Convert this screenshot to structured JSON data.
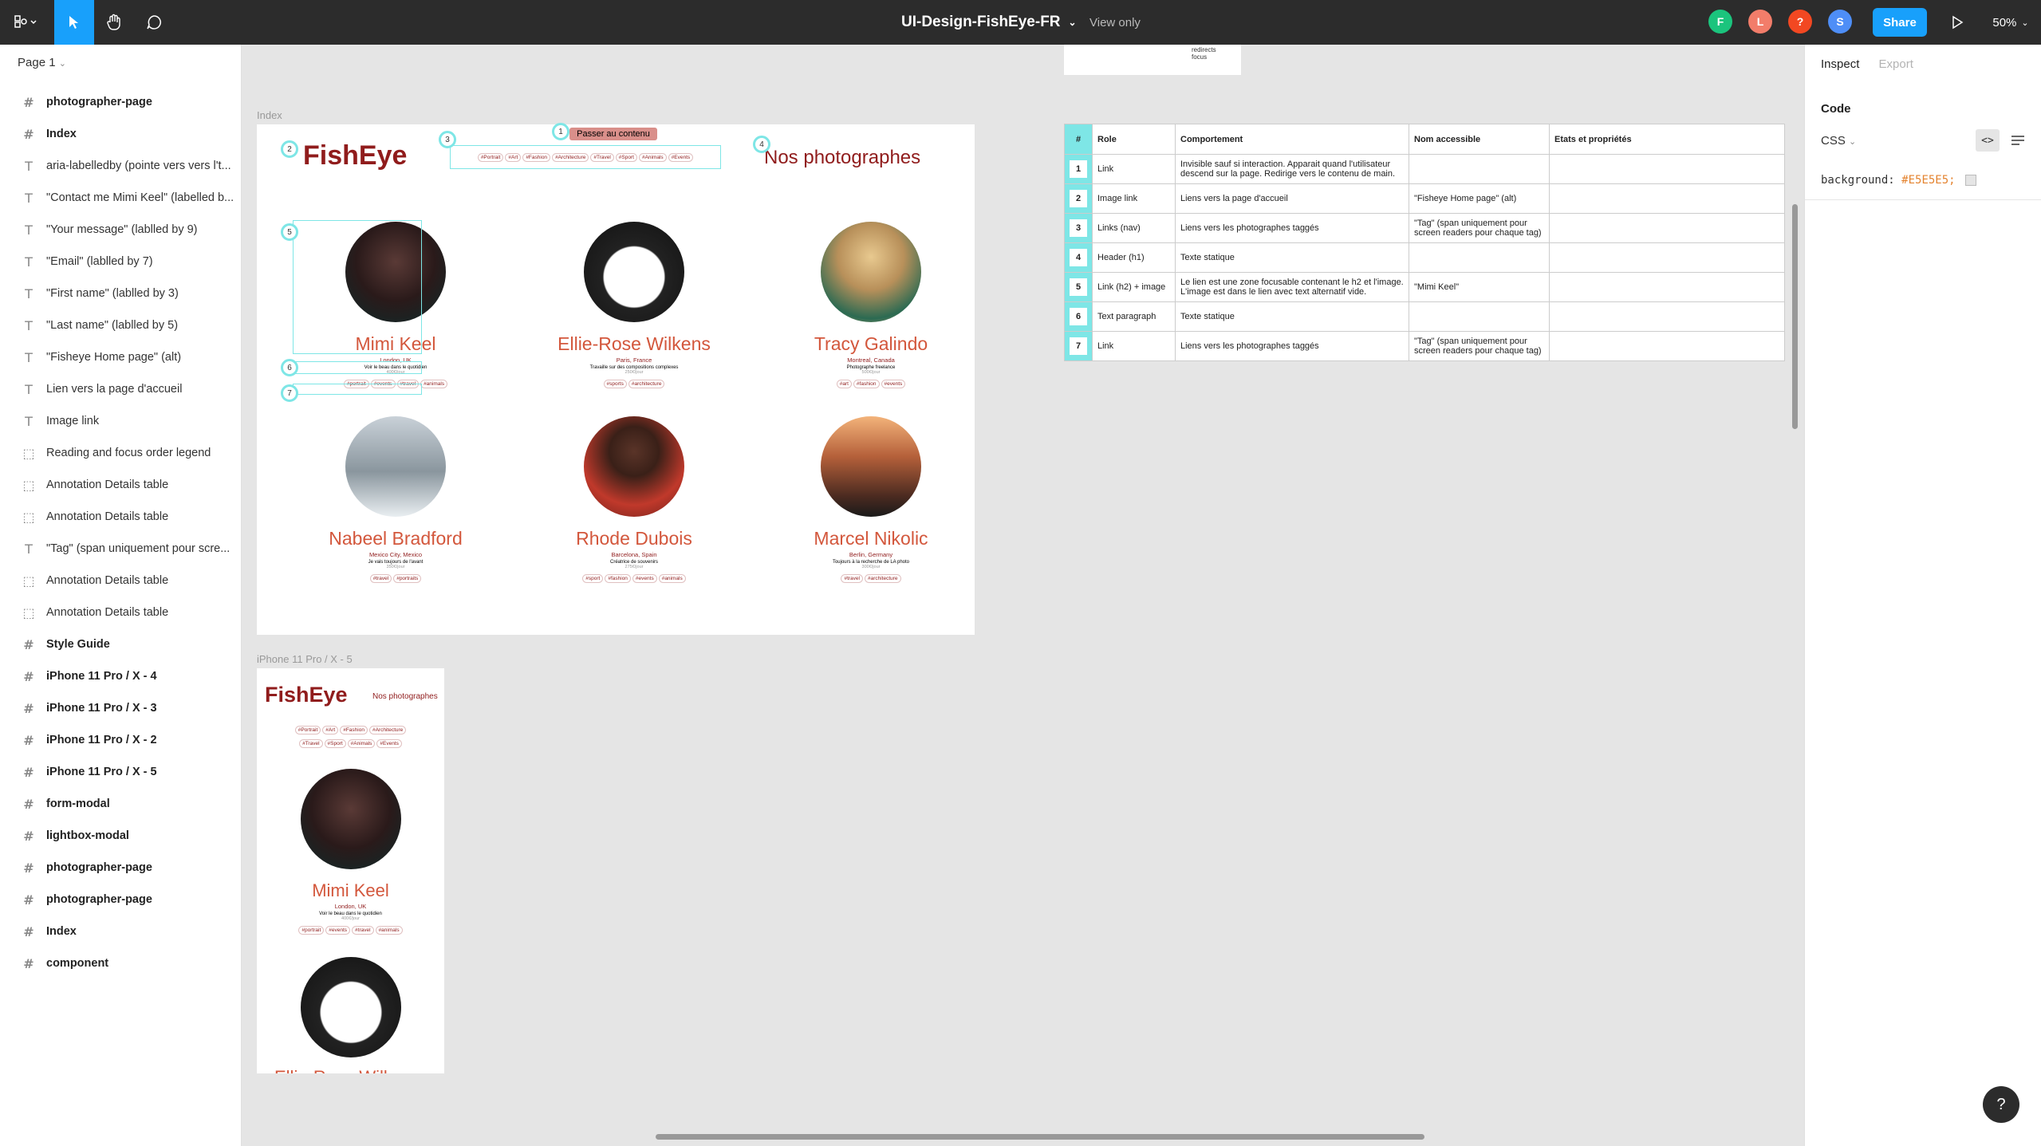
{
  "toolbar": {
    "file_title": "UI-Design-FishEye-FR",
    "view_mode": "View only",
    "share_label": "Share",
    "zoom": "50%",
    "avatars": [
      {
        "letter": "F",
        "color": "#1bc47d"
      },
      {
        "letter": "L",
        "color": "#f27d6a"
      },
      {
        "letter": "?",
        "color": "#f24822"
      },
      {
        "letter": "S",
        "color": "#4e8ef7"
      }
    ]
  },
  "left_panel": {
    "page_selector": "Page 1",
    "layers": [
      {
        "icon": "frame-icon",
        "label": "photographer-page",
        "type": "frame"
      },
      {
        "icon": "frame-icon",
        "label": "Index",
        "type": "frame"
      },
      {
        "icon": "text-icon",
        "label": "aria-labelledby (pointe vers vers l't...",
        "type": "text"
      },
      {
        "icon": "text-icon",
        "label": "\"Contact me Mimi Keel\" (labelled b...",
        "type": "text"
      },
      {
        "icon": "text-icon",
        "label": "\"Your message\" (lablled by 9)",
        "type": "text"
      },
      {
        "icon": "text-icon",
        "label": "\"Email\" (lablled by 7)",
        "type": "text"
      },
      {
        "icon": "text-icon",
        "label": "\"First name\" (lablled by 3)",
        "type": "text"
      },
      {
        "icon": "text-icon",
        "label": "\"Last name\" (lablled by 5)",
        "type": "text"
      },
      {
        "icon": "text-icon",
        "label": "\"Fisheye Home page\" (alt)",
        "type": "text"
      },
      {
        "icon": "text-icon",
        "label": "Lien vers la page d'accueil",
        "type": "text"
      },
      {
        "icon": "text-icon",
        "label": "Image link",
        "type": "text"
      },
      {
        "icon": "group-icon",
        "label": "Reading and focus order legend",
        "type": "group"
      },
      {
        "icon": "group-icon",
        "label": "Annotation Details table",
        "type": "group"
      },
      {
        "icon": "group-icon",
        "label": "Annotation Details table",
        "type": "group"
      },
      {
        "icon": "text-icon",
        "label": "\"Tag\" (span uniquement pour scre...",
        "type": "text"
      },
      {
        "icon": "group-icon",
        "label": "Annotation Details table",
        "type": "group"
      },
      {
        "icon": "group-icon",
        "label": "Annotation Details table",
        "type": "group"
      },
      {
        "icon": "frame-icon",
        "label": "Style Guide",
        "type": "frame"
      },
      {
        "icon": "frame-icon",
        "label": "iPhone 11 Pro / X - 4",
        "type": "frame"
      },
      {
        "icon": "frame-icon",
        "label": "iPhone 11 Pro / X - 3",
        "type": "frame"
      },
      {
        "icon": "frame-icon",
        "label": "iPhone 11 Pro / X - 2",
        "type": "frame"
      },
      {
        "icon": "frame-icon",
        "label": "iPhone 11 Pro / X - 5",
        "type": "frame"
      },
      {
        "icon": "frame-icon",
        "label": "form-modal",
        "type": "frame"
      },
      {
        "icon": "frame-icon",
        "label": "lightbox-modal",
        "type": "frame"
      },
      {
        "icon": "frame-icon",
        "label": "photographer-page",
        "type": "frame"
      },
      {
        "icon": "frame-icon",
        "label": "photographer-page",
        "type": "frame"
      },
      {
        "icon": "frame-icon",
        "label": "Index",
        "type": "frame"
      },
      {
        "icon": "frame-icon",
        "label": "component",
        "type": "frame"
      }
    ]
  },
  "canvas": {
    "index_label": "Index",
    "phone_label": "iPhone 11 Pro / X - 5",
    "top_snippet": "redirects focus",
    "index_frame": {
      "logo": "FishEye",
      "skip_link": "Passer au contenu",
      "heading": "Nos photographes",
      "nav_tags": [
        "#Portrait",
        "#Art",
        "#Fashion",
        "#Architecture",
        "#Travel",
        "#Sport",
        "#Animals",
        "#Events"
      ],
      "photographers": [
        {
          "name": "Mimi Keel",
          "location": "London, UK",
          "tagline": "Voir le beau dans le quotidien",
          "price": "400€/jour",
          "tags": [
            "#portrait",
            "#events",
            "#travel",
            "#animals"
          ],
          "color": "#3a2a2a"
        },
        {
          "name": "Ellie-Rose Wilkens",
          "location": "Paris, France",
          "tagline": "Travaille sur des compositions complexes",
          "price": "250€/jour",
          "tags": [
            "#sports",
            "#architecture"
          ],
          "color": "#1a1a1a"
        },
        {
          "name": "Tracy Galindo",
          "location": "Montreal, Canada",
          "tagline": "Photographe freelance",
          "price": "500€/jour",
          "tags": [
            "#art",
            "#fashion",
            "#events"
          ],
          "color": "#c9a86a"
        },
        {
          "name": "Nabeel Bradford",
          "location": "Mexico City, Mexico",
          "tagline": "Je vais toujours de l'avant",
          "price": "350€/jour",
          "tags": [
            "#travel",
            "#portraits"
          ],
          "color": "#a9b4bd"
        },
        {
          "name": "Rhode Dubois",
          "location": "Barcelona, Spain",
          "tagline": "Créatrice de souvenirs",
          "price": "275€/jour",
          "tags": [
            "#sport",
            "#fashion",
            "#events",
            "#animals"
          ],
          "color": "#c0392b"
        },
        {
          "name": "Marcel Nikolic",
          "location": "Berlin, Germany",
          "tagline": "Toujours à la recherche de LA photo",
          "price": "300€/jour",
          "tags": [
            "#travel",
            "#architecture"
          ],
          "color": "#8a4b2e"
        }
      ],
      "badges": [
        "1",
        "2",
        "3",
        "4",
        "5",
        "6",
        "7"
      ]
    },
    "phone_frame": {
      "logo": "FishEye",
      "heading": "Nos photographes",
      "tags_row1": [
        "#Portrait",
        "#Art",
        "#Fashion",
        "#Architecture"
      ],
      "tags_row2": [
        "#Travel",
        "#Sport",
        "#Animals",
        "#Events"
      ],
      "first": {
        "name": "Mimi Keel",
        "location": "London, UK",
        "tagline": "Voir le beau dans le quotidien",
        "price": "400€/jour",
        "tags": [
          "#portrait",
          "#events",
          "#travel",
          "#animals"
        ]
      },
      "second_name_partial": "Ellie-Rose Wilk"
    },
    "annotation_table": {
      "headers": [
        "#",
        "Role",
        "Comportement",
        "Nom accessible",
        "Etats et propriétés"
      ],
      "rows": [
        {
          "num": "1",
          "role": "Link",
          "behavior": "Invisible sauf si interaction. Apparait quand l'utilisateur descend sur la page. Redirige vers le contenu de main.",
          "name": "",
          "states": ""
        },
        {
          "num": "2",
          "role": "Image link",
          "behavior": "Liens vers la page d'accueil",
          "name": "\"Fisheye Home page\" (alt)",
          "states": ""
        },
        {
          "num": "3",
          "role": "Links (nav)",
          "behavior": "Liens vers les photographes taggés",
          "name": "\"Tag\" (span uniquement pour screen readers pour chaque tag)",
          "states": ""
        },
        {
          "num": "4",
          "role": "Header (h1)",
          "behavior": "Texte statique",
          "name": "",
          "states": ""
        },
        {
          "num": "5",
          "role": "Link (h2) + image",
          "behavior": "Le lien est une zone focusable contenant le h2 et l'image. L'image est dans le lien avec text alternatif vide.",
          "name": "\"Mimi Keel\"",
          "states": ""
        },
        {
          "num": "6",
          "role": "Text paragraph",
          "behavior": "Texte statique",
          "name": "",
          "states": ""
        },
        {
          "num": "7",
          "role": "Link",
          "behavior": "Liens vers les photographes taggés",
          "name": "\"Tag\" (span uniquement pour screen readers pour chaque tag)",
          "states": ""
        }
      ]
    }
  },
  "right_panel": {
    "tab_inspect": "Inspect",
    "tab_export": "Export",
    "code_label": "Code",
    "lang": "CSS",
    "css_prop": "background:",
    "css_value": "#E5E5E5;"
  },
  "help_label": "?"
}
